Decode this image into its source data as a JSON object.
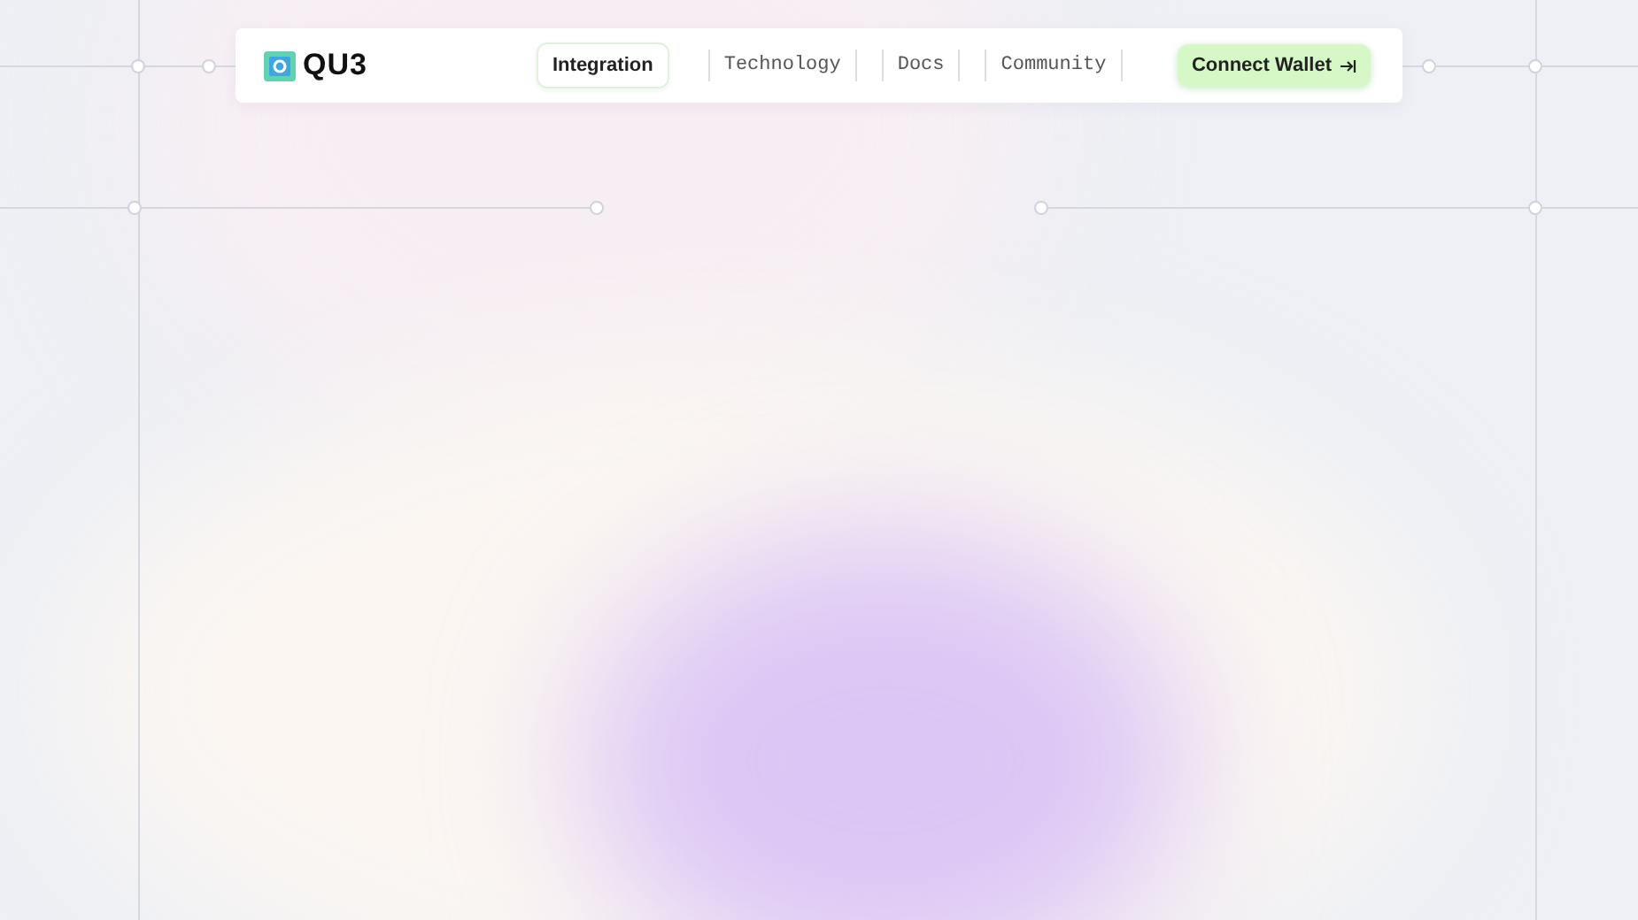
{
  "header": {
    "logo": "QU3",
    "nav": [
      {
        "label": "Integration",
        "selected": true
      },
      {
        "label": "Technology",
        "selected": false
      },
      {
        "label": "Docs",
        "selected": false
      },
      {
        "label": "Community",
        "selected": false
      }
    ],
    "cta": "Connect Wallet"
  }
}
